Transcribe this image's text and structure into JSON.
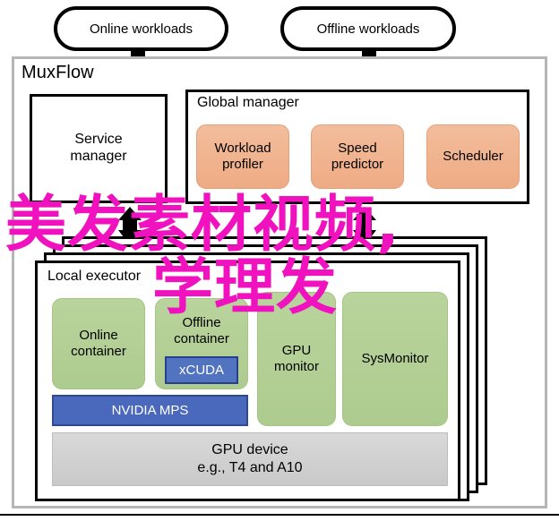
{
  "diagram": {
    "title": "MuxFlow",
    "inputs": [
      {
        "label": "Online workloads",
        "name": "online-workloads"
      },
      {
        "label": "Offline workloads",
        "name": "offline-workloads"
      }
    ],
    "service_manager": {
      "label": "Service\nmanager",
      "line1": "Service",
      "line2": "manager"
    },
    "global_manager": {
      "label": "Global manager",
      "modules": [
        {
          "line1": "Workload",
          "line2": "profiler"
        },
        {
          "line1": "Speed",
          "line2": "predictor"
        },
        {
          "line1": "Scheduler",
          "line2": ""
        }
      ]
    },
    "local_executor": {
      "label": "Local executor",
      "containers": [
        {
          "line1": "Online",
          "line2": "container"
        },
        {
          "line1": "Offline",
          "line2": "container"
        }
      ],
      "xcuda_label": "xCUDA",
      "mps_label": "NVIDIA MPS",
      "monitors": [
        {
          "line1": "GPU",
          "line2": "monitor"
        },
        {
          "line1": "SysMonitor",
          "line2": ""
        }
      ],
      "gpu_device": {
        "line1": "GPU device",
        "line2": "e.g., T4 and A10"
      }
    }
  },
  "watermark": {
    "line1": "美发素材视频,",
    "line2": "学理发"
  },
  "colors": {
    "salmon": "#eeab84",
    "green": "#aecb8f",
    "blue": "#4a69bd",
    "xcuda_blue": "#5273c0",
    "gray": "#cfcfcf",
    "frame_gray": "#b6b6b6",
    "black": "#000000",
    "watermark_magenta": "#f012be"
  }
}
